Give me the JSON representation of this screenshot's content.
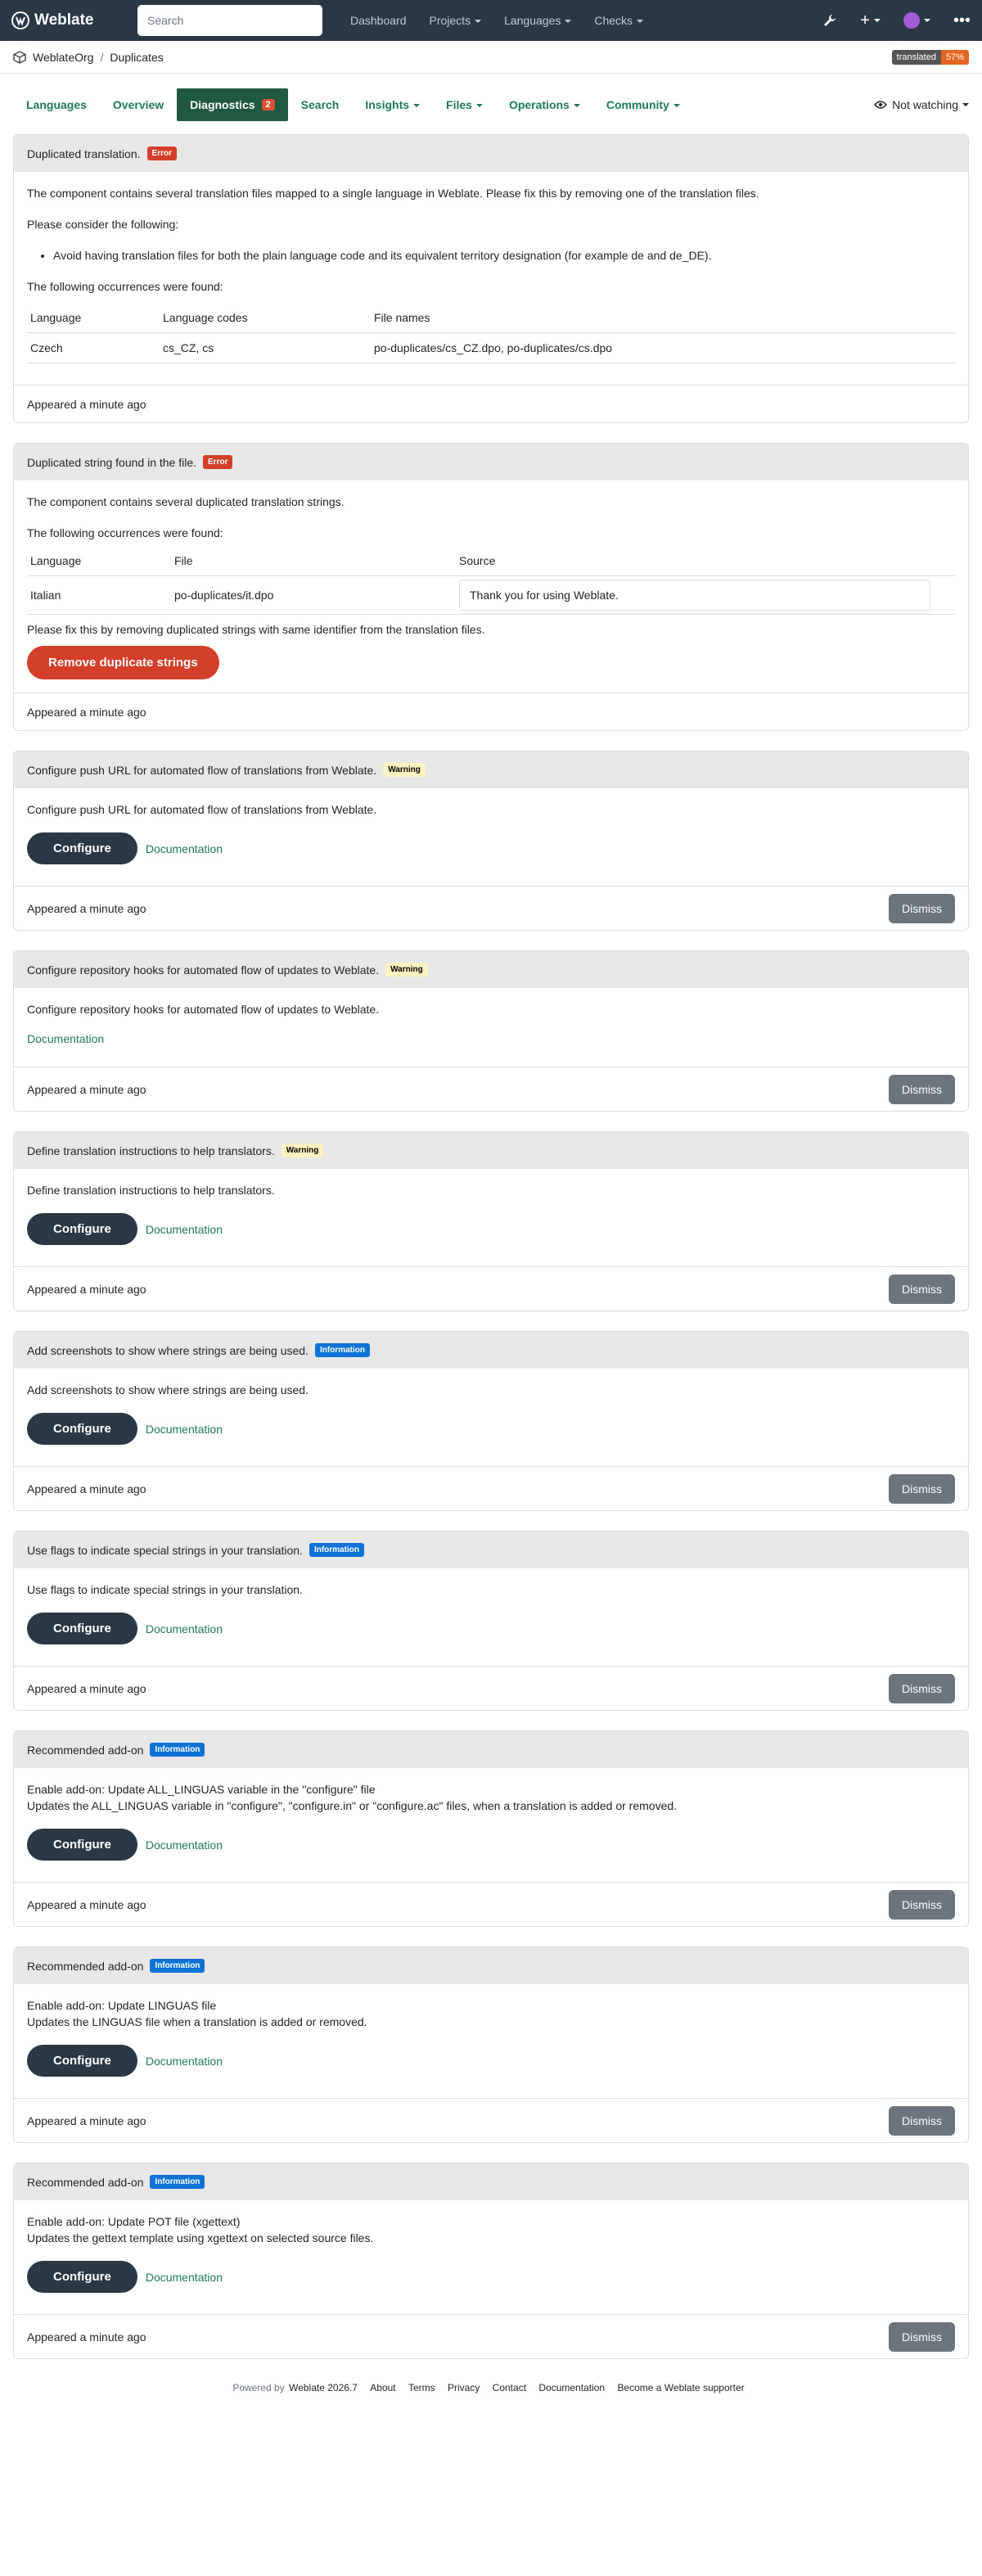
{
  "nav": {
    "brand": "Weblate",
    "search_placeholder": "Search",
    "links": [
      "Dashboard",
      "Projects",
      "Languages",
      "Checks"
    ]
  },
  "breadcrumb": {
    "project": "WeblateOrg",
    "component": "Duplicates"
  },
  "badge": {
    "label": "translated",
    "value": "57%"
  },
  "tabs": {
    "languages": "Languages",
    "overview": "Overview",
    "diagnostics": "Diagnostics",
    "diagnostics_count": "2",
    "search": "Search",
    "insights": "Insights",
    "files": "Files",
    "operations": "Operations",
    "community": "Community",
    "watch": "Not watching"
  },
  "common": {
    "appeared": "Appeared a minute ago",
    "configure": "Configure",
    "documentation": "Documentation",
    "dismiss": "Dismiss",
    "error": "Error",
    "warning": "Warning",
    "information": "Information"
  },
  "card1": {
    "title": "Duplicated translation.",
    "p1": "The component contains several translation files mapped to a single language in Weblate. Please fix this by removing one of the translation files.",
    "p2": "Please consider the following:",
    "li1": "Avoid having translation files for both the plain language code and its equivalent territory designation (for example de and de_DE).",
    "p3": "The following occurrences were found:",
    "headers": [
      "Language",
      "Language codes",
      "File names"
    ],
    "row": [
      "Czech",
      "cs_CZ, cs",
      "po-duplicates/cs_CZ.dpo, po-duplicates/cs.dpo"
    ]
  },
  "card2": {
    "title": "Duplicated string found in the file.",
    "p1": "The component contains several duplicated translation strings.",
    "p2": "The following occurrences were found:",
    "headers": [
      "Language",
      "File",
      "Source"
    ],
    "row": [
      "Italian",
      "po-duplicates/it.dpo",
      "Thank you for using Weblate."
    ],
    "p3": "Please fix this by removing duplicated strings with same identifier from the translation files.",
    "button": "Remove duplicate strings"
  },
  "card3": {
    "title": "Configure push URL for automated flow of translations from Weblate.",
    "body": "Configure push URL for automated flow of translations from Weblate."
  },
  "card4": {
    "title": "Configure repository hooks for automated flow of updates to Weblate.",
    "body": "Configure repository hooks for automated flow of updates to Weblate."
  },
  "card5": {
    "title": "Define translation instructions to help translators.",
    "body": "Define translation instructions to help translators."
  },
  "card6": {
    "title": "Add screenshots to show where strings are being used.",
    "body": "Add screenshots to show where strings are being used."
  },
  "card7": {
    "title": "Use flags to indicate special strings in your translation.",
    "body": "Use flags to indicate special strings in your translation."
  },
  "card8": {
    "title": "Recommended add-on",
    "line1": "Enable add-on: Update ALL_LINGUAS variable in the \"configure\" file",
    "line2": "Updates the ALL_LINGUAS variable in \"configure\", \"configure.in\" or \"configure.ac\" files, when a translation is added or removed."
  },
  "card9": {
    "title": "Recommended add-on",
    "line1": "Enable add-on: Update LINGUAS file",
    "line2": "Updates the LINGUAS file when a translation is added or removed."
  },
  "card10": {
    "title": "Recommended add-on",
    "line1": "Enable add-on: Update POT file (xgettext)",
    "line2": "Updates the gettext template using xgettext on selected source files."
  },
  "footer": {
    "powered": "Powered by",
    "version": "Weblate 2026.7",
    "links": [
      "About",
      "Terms",
      "Privacy",
      "Contact",
      "Documentation",
      "Become a Weblate supporter"
    ]
  }
}
